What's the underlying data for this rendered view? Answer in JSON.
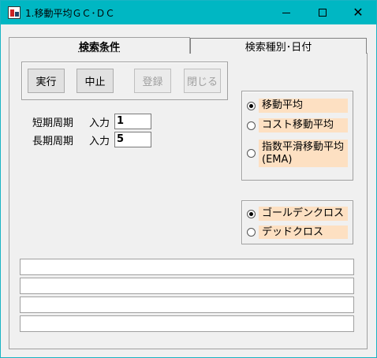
{
  "window": {
    "title": "1.移動平均ＧＣ･ＤＣ",
    "minimize": "—",
    "maximize": "☐",
    "close": "✕"
  },
  "tabs": [
    {
      "label": "検索条件",
      "active": true
    },
    {
      "label": "検索種別･日付",
      "active": false
    }
  ],
  "buttons": {
    "execute": "実行",
    "stop": "中止",
    "register": "登録",
    "close": "閉じる"
  },
  "periods": {
    "short_label": "短期周期",
    "long_label": "長期周期",
    "input_label": "入力",
    "short_value": "1",
    "long_value": "5"
  },
  "ma_types": [
    {
      "label": "移動平均",
      "selected": true
    },
    {
      "label": "コスト移動平均",
      "selected": false
    },
    {
      "label": "指数平滑移動平均(EMA)",
      "selected": false
    }
  ],
  "signals": [
    {
      "label": "ゴールデンクロス",
      "selected": true
    },
    {
      "label": "デッドクロス",
      "selected": false
    }
  ],
  "log_lines": [
    "",
    "",
    "",
    ""
  ],
  "colors": {
    "titlebar": "#00b7c3",
    "option_highlight": "#fde0c2"
  }
}
